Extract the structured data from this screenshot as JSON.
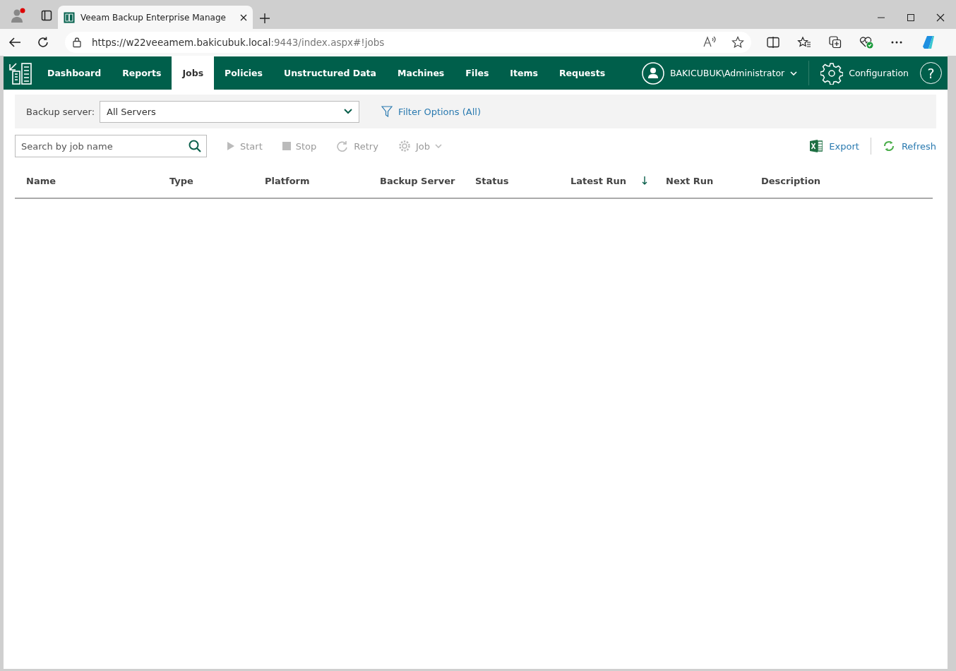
{
  "browser": {
    "tab_title": "Veeam Backup Enterprise Manage",
    "url_host": "https://w22veeamem.bakicubuk.local",
    "url_path": ":9443/index.aspx#!jobs"
  },
  "nav": {
    "items": [
      {
        "label": "Dashboard",
        "selected": false
      },
      {
        "label": "Reports",
        "selected": false
      },
      {
        "label": "Jobs",
        "selected": true
      },
      {
        "label": "Policies",
        "selected": false
      },
      {
        "label": "Unstructured Data",
        "selected": false
      },
      {
        "label": "Machines",
        "selected": false
      },
      {
        "label": "Files",
        "selected": false
      },
      {
        "label": "Items",
        "selected": false
      },
      {
        "label": "Requests",
        "selected": false
      }
    ],
    "user": "BAKICUBUK\\Administrator",
    "configuration": "Configuration",
    "help": "?"
  },
  "filter": {
    "label": "Backup server:",
    "value": "All Servers",
    "filter_options": "Filter Options (All)"
  },
  "toolbar": {
    "search": {
      "placeholder": "Search by job name"
    },
    "actions": [
      {
        "kind": "start",
        "label": "Start",
        "disabled": true
      },
      {
        "kind": "stop",
        "label": "Stop",
        "disabled": true
      },
      {
        "kind": "retry",
        "label": "Retry",
        "disabled": true
      },
      {
        "kind": "job",
        "label": "Job",
        "disabled": true
      }
    ],
    "right_actions": [
      {
        "kind": "export",
        "label": "Export"
      },
      {
        "kind": "refresh",
        "label": "Refresh"
      }
    ]
  },
  "table": {
    "columns": [
      {
        "label": "Name",
        "sorted": false
      },
      {
        "label": "Type",
        "sorted": false
      },
      {
        "label": "Platform",
        "sorted": false
      },
      {
        "label": "Backup Server",
        "sorted": false
      },
      {
        "label": "Status",
        "sorted": false
      },
      {
        "label": "Latest Run",
        "sorted": true
      },
      {
        "label": "Next Run",
        "sorted": false
      },
      {
        "label": "Description",
        "sorted": false
      }
    ]
  }
}
